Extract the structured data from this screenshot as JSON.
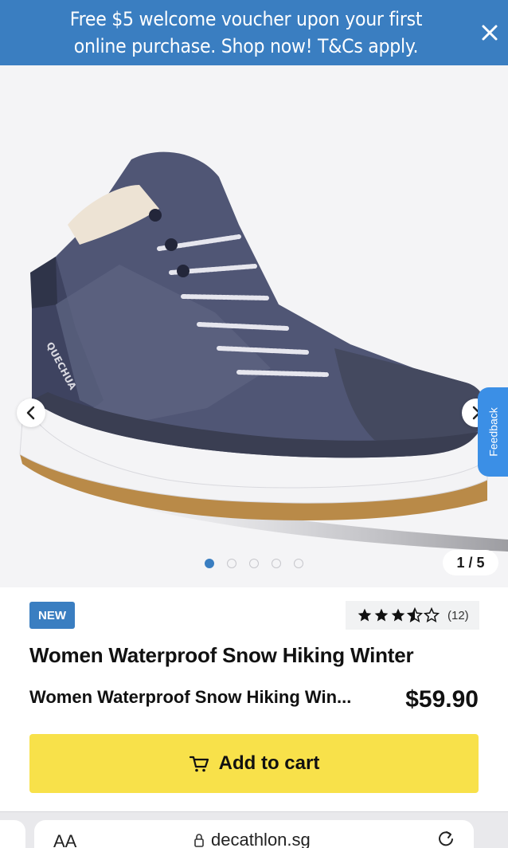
{
  "banner": {
    "text": "Free $5 welcome voucher upon your first online purchase. Shop now! T&Cs apply."
  },
  "gallery": {
    "counter": "1 / 5",
    "current_index": 1,
    "total_images": 5,
    "boot_brand_text": "QUECHUA",
    "feedback_label": "Feedback"
  },
  "product": {
    "badge": "NEW",
    "rating": 3.5,
    "review_count": "(12)",
    "title": "Women Waterproof Snow Hiking Winter",
    "subtitle": "Women Waterproof Snow Hiking Win...",
    "price": "$59.90",
    "add_to_cart_label": "Add to cart"
  },
  "browser": {
    "text_size_label": "AA",
    "url": "decathlon.sg"
  },
  "colors": {
    "brand_blue": "#3a7ec1",
    "cta_yellow": "#f8e14a",
    "feedback_blue": "#3b8fe6"
  },
  "icons": {
    "close": "close-icon",
    "prev": "chevron-left-icon",
    "next": "chevron-right-icon",
    "cart": "cart-icon",
    "lock": "lock-icon",
    "reload": "reload-icon",
    "star": "star-icon"
  }
}
